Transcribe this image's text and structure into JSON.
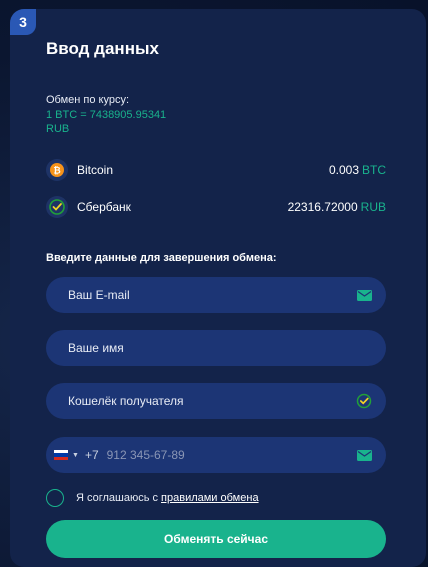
{
  "step": "3",
  "title": "Ввод данных",
  "rate": {
    "label": "Обмен по курсу:",
    "value": "1 BTC = 7438905.95341 RUB"
  },
  "give": {
    "name": "Bitcoin",
    "amount": "0.003",
    "unit": "BTC",
    "icon": "bitcoin-icon"
  },
  "receive": {
    "name": "Сбербанк",
    "amount": "22316.72000",
    "unit": "RUB",
    "icon": "sberbank-icon"
  },
  "form": {
    "label": "Введите данные для завершения обмена:",
    "email": "Ваш E-mail",
    "name": "Ваше имя",
    "wallet": "Кошелёк получателя",
    "phone_code": "+7",
    "phone_placeholder": "912 345-67-89"
  },
  "agree": {
    "text": "Я соглашаюсь с",
    "link": "правилами обмена"
  },
  "submit_label": "Обменять сейчас",
  "colors": {
    "accent": "#19b38d",
    "card": "#13234a",
    "field": "#1c3575",
    "badge": "#2a58b5"
  }
}
